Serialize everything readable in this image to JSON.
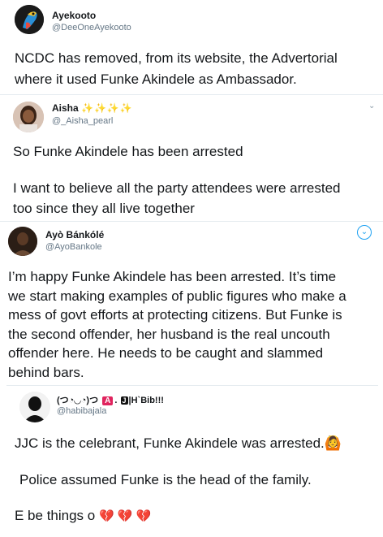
{
  "tweet1": {
    "name": "Ayekooto",
    "handle": "@DeeOneAyekooto",
    "avatar_icon": "parrot-avatar",
    "text_line1": "NCDC has removed, from its website, the Advertorial",
    "text_line2": "where it used Funke Akindele as Ambassador."
  },
  "tweet2": {
    "name": "Aisha",
    "name_suffix": "✨✨✨✨",
    "handle": "@_Aisha_pearl",
    "avatar_icon": "woman-avatar",
    "para1": "So Funke Akindele has been arrested",
    "para2_line1": "I want to believe all the party attendees were arrested",
    "para2_line2": "too since they all live together"
  },
  "tweet3": {
    "name": "Ayò Bánkólé",
    "handle": "@AyoBankole",
    "avatar_icon": "man-avatar",
    "lines": [
      "I’m happy Funke Akindele has been arrested. It’s time",
      "we start making examples of public figures who make a",
      "mess of govt efforts at protecting citizens. But Funke is",
      "the second offender, her husband is the real uncouth",
      "offender here. He needs to be caught and slammed",
      "behind bars."
    ]
  },
  "tweet4": {
    "name_prefix": "(つ◔◡◔)つ",
    "name_badge1": "A",
    "name_mid": ".",
    "name_badge2": "J",
    "name_suffix": "|H`Bib!!!",
    "handle": "@habibajala",
    "avatar_icon": "person-silhouette-avatar",
    "line1": "JJC is the celebrant, Funke Akindele was arrested.",
    "line1_emoji": "🙆",
    "line2": "Police assumed Funke is the head of the family.",
    "line3": "E be things o",
    "hearts": "💔 💔 💔"
  },
  "colors": {
    "text": "#14171a",
    "secondary": "#657786",
    "separator": "#e6ecf0",
    "heart": "#e0245e"
  }
}
